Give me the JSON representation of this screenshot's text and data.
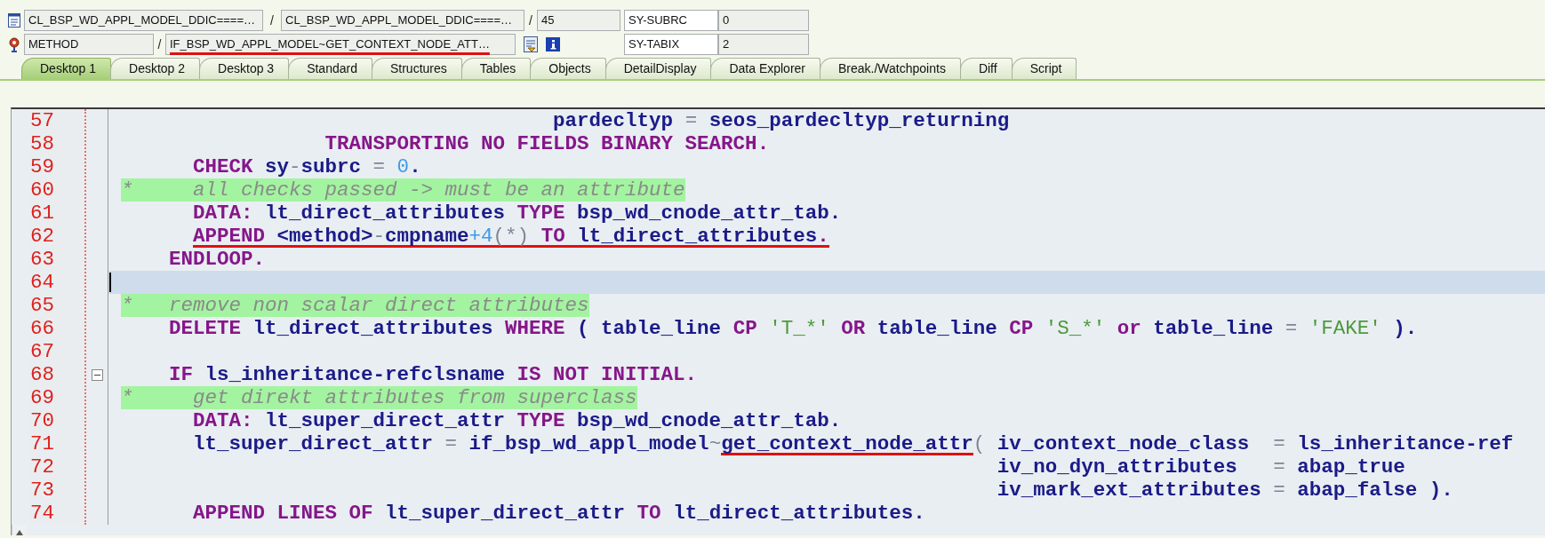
{
  "header": {
    "rows": [
      {
        "kind": "program",
        "items": [
          {
            "kind": "field",
            "text": "CL_BSP_WD_APPL_MODEL_DDIC====…",
            "marked": false
          },
          {
            "kind": "separator",
            "text": "/"
          },
          {
            "kind": "field",
            "text": "CL_BSP_WD_APPL_MODEL_DDIC====…",
            "marked": false
          },
          {
            "kind": "separator",
            "text": "/"
          },
          {
            "kind": "field",
            "text": "45",
            "marked": false
          },
          {
            "kind": "variable",
            "name": "SY-SUBRC",
            "value": "0"
          }
        ]
      },
      {
        "kind": "method",
        "items": [
          {
            "kind": "field",
            "text": "METHOD",
            "marked": false
          },
          {
            "kind": "separator",
            "text": "/"
          },
          {
            "kind": "field",
            "text": "IF_BSP_WD_APPL_MODEL~GET_CONTEXT_NODE_ATT…",
            "marked": true
          },
          {
            "kind": "navigate-button"
          },
          {
            "kind": "info-button"
          },
          {
            "kind": "variable",
            "name": "SY-TABIX",
            "value": "2"
          }
        ]
      }
    ]
  },
  "tabs": [
    {
      "label": "Desktop 1",
      "selected": true
    },
    {
      "label": "Desktop 2",
      "selected": false
    },
    {
      "label": "Desktop 3",
      "selected": false
    },
    {
      "label": "Standard",
      "selected": false
    },
    {
      "label": "Structures",
      "selected": false
    },
    {
      "label": "Tables",
      "selected": false
    },
    {
      "label": "Objects",
      "selected": false
    },
    {
      "label": "DetailDisplay",
      "selected": false
    },
    {
      "label": "Data Explorer",
      "selected": false
    },
    {
      "label": "Break./Watchpoints",
      "selected": false
    },
    {
      "label": "Diff",
      "selected": false
    },
    {
      "label": "Script",
      "selected": false
    }
  ],
  "editor": {
    "lines": [
      {
        "number": "57",
        "current": false,
        "tokens": [
          {
            "kind": "identifier",
            "text": "                                    pardecltyp"
          },
          {
            "kind": "operator",
            "text": " = "
          },
          {
            "kind": "identifier",
            "text": "seos_pardecltyp_returning"
          }
        ]
      },
      {
        "number": "58",
        "current": false,
        "tokens": [
          {
            "kind": "keyword",
            "text": "                 TRANSPORTING NO FIELDS BINARY SEARCH."
          }
        ]
      },
      {
        "number": "59",
        "current": false,
        "tokens": [
          {
            "kind": "keyword",
            "text": "      CHECK "
          },
          {
            "kind": "identifier",
            "text": "sy"
          },
          {
            "kind": "operator",
            "text": "-"
          },
          {
            "kind": "identifier",
            "text": "subrc"
          },
          {
            "kind": "operator",
            "text": " = "
          },
          {
            "kind": "number",
            "text": "0"
          },
          {
            "kind": "identifier",
            "text": "."
          }
        ]
      },
      {
        "number": "60",
        "current": false,
        "tokens": [
          {
            "kind": "comment",
            "text": "*     all checks passed -> must be an attribute"
          }
        ]
      },
      {
        "number": "61",
        "current": false,
        "tokens": [
          {
            "kind": "keyword",
            "text": "      DATA: "
          },
          {
            "kind": "identifier",
            "text": "lt_direct_attributes "
          },
          {
            "kind": "keyword",
            "text": "TYPE "
          },
          {
            "kind": "identifier",
            "text": "bsp_wd_cnode_attr_tab."
          }
        ]
      },
      {
        "number": "62",
        "current": false,
        "tokens": [
          {
            "kind": "keyword",
            "text": "      APPEND ",
            "marked": true
          },
          {
            "kind": "identifier",
            "text": "<method>",
            "marked": true
          },
          {
            "kind": "operator",
            "text": "-",
            "marked": true
          },
          {
            "kind": "identifier",
            "text": "cmpname",
            "marked": true
          },
          {
            "kind": "number",
            "text": "+4",
            "marked": true
          },
          {
            "kind": "operator",
            "text": "(*) ",
            "marked": true
          },
          {
            "kind": "keyword",
            "text": "TO ",
            "marked": true
          },
          {
            "kind": "identifier",
            "text": "lt_direct_attributes",
            "marked": true
          },
          {
            "kind": "keyword",
            "text": ".",
            "marked": true
          }
        ]
      },
      {
        "number": "63",
        "current": false,
        "tokens": [
          {
            "kind": "keyword",
            "text": "    ENDLOOP."
          }
        ]
      },
      {
        "number": "64",
        "current": true
      },
      {
        "number": "65",
        "current": false,
        "tokens": [
          {
            "kind": "comment",
            "text": "*   remove non scalar direct attributes"
          }
        ]
      },
      {
        "number": "66",
        "current": false,
        "tokens": [
          {
            "kind": "keyword",
            "text": "    DELETE "
          },
          {
            "kind": "identifier",
            "text": "lt_direct_attributes "
          },
          {
            "kind": "keyword",
            "text": "WHERE "
          },
          {
            "kind": "identifier",
            "text": "( table_line "
          },
          {
            "kind": "keyword",
            "text": "CP "
          },
          {
            "kind": "string",
            "text": "'T_*' "
          },
          {
            "kind": "keyword",
            "text": "OR "
          },
          {
            "kind": "identifier",
            "text": "table_line "
          },
          {
            "kind": "keyword",
            "text": "CP "
          },
          {
            "kind": "string",
            "text": "'S_*' "
          },
          {
            "kind": "keyword",
            "text": "or "
          },
          {
            "kind": "identifier",
            "text": "table_line "
          },
          {
            "kind": "operator",
            "text": "= "
          },
          {
            "kind": "string",
            "text": "'FAKE' "
          },
          {
            "kind": "identifier",
            "text": ")."
          }
        ]
      },
      {
        "number": "67",
        "current": false
      },
      {
        "number": "68",
        "current": false,
        "expanded": true,
        "tokens": [
          {
            "kind": "keyword",
            "text": "    IF "
          },
          {
            "kind": "identifier",
            "text": "ls_inheritance-refclsname "
          },
          {
            "kind": "keyword",
            "text": "IS NOT INITIAL."
          }
        ]
      },
      {
        "number": "69",
        "current": false,
        "tokens": [
          {
            "kind": "comment",
            "text": "*     get direkt attributes from superclass"
          }
        ]
      },
      {
        "number": "70",
        "current": false,
        "tokens": [
          {
            "kind": "keyword",
            "text": "      DATA: "
          },
          {
            "kind": "identifier",
            "text": "lt_super_direct_attr "
          },
          {
            "kind": "keyword",
            "text": "TYPE "
          },
          {
            "kind": "identifier",
            "text": "bsp_wd_cnode_attr_tab."
          }
        ]
      },
      {
        "number": "71",
        "current": false,
        "tokens": [
          {
            "kind": "identifier",
            "text": "      lt_super_direct_attr "
          },
          {
            "kind": "operator",
            "text": "= "
          },
          {
            "kind": "identifier",
            "text": "if_bsp_wd_appl_model"
          },
          {
            "kind": "operator",
            "text": "~"
          },
          {
            "kind": "identifier",
            "text": "get_context_node_attr",
            "marked": true
          },
          {
            "kind": "operator",
            "text": "( "
          },
          {
            "kind": "identifier",
            "text": "iv_context_node_class  "
          },
          {
            "kind": "operator",
            "text": "= "
          },
          {
            "kind": "identifier",
            "text": "ls_inheritance-ref"
          }
        ]
      },
      {
        "number": "72",
        "current": false,
        "tokens": [
          {
            "kind": "identifier",
            "text": "                                                                         iv_no_dyn_attributes   "
          },
          {
            "kind": "operator",
            "text": "= "
          },
          {
            "kind": "identifier",
            "text": "abap_true"
          }
        ]
      },
      {
        "number": "73",
        "current": false,
        "tokens": [
          {
            "kind": "identifier",
            "text": "                                                                         iv_mark_ext_attributes "
          },
          {
            "kind": "operator",
            "text": "= "
          },
          {
            "kind": "identifier",
            "text": "abap_false )."
          }
        ]
      },
      {
        "number": "74",
        "current": false,
        "tokens": [
          {
            "kind": "keyword",
            "text": "      APPEND LINES OF "
          },
          {
            "kind": "identifier",
            "text": "lt_super_direct_attr "
          },
          {
            "kind": "keyword",
            "text": "TO "
          },
          {
            "kind": "identifier",
            "text": "lt_direct_attributes."
          }
        ]
      }
    ]
  }
}
